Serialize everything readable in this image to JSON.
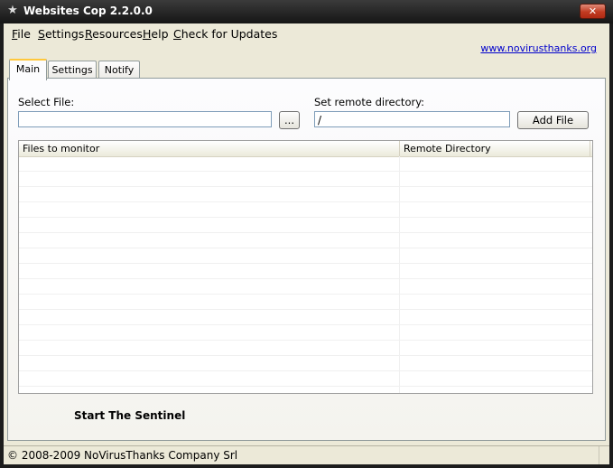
{
  "window": {
    "title": "Websites Cop 2.2.0.0",
    "close_label": "✕"
  },
  "menu": [
    {
      "label": "File",
      "underline": "F",
      "rest": "ile"
    },
    {
      "label": "Settings",
      "underline": "S",
      "rest": "ettings"
    },
    {
      "label": "Resources",
      "underline": "R",
      "rest": "esources"
    },
    {
      "label": "Help",
      "underline": "H",
      "rest": "elp"
    },
    {
      "label": "Check for Updates",
      "underline": "C",
      "rest": "heck for Updates"
    }
  ],
  "site_link": "www.novirusthanks.org",
  "tabs": [
    {
      "label": "Main",
      "active": true
    },
    {
      "label": "Settings",
      "active": false
    },
    {
      "label": "Notify",
      "active": false
    }
  ],
  "main": {
    "select_file_label": "Select File:",
    "select_file_value": "",
    "browse_label": "...",
    "remote_dir_label": "Set remote directory:",
    "remote_dir_value": "/",
    "add_file_label": "Add File",
    "list": {
      "columns": [
        "Files to monitor",
        "Remote Directory"
      ],
      "rows": []
    },
    "start_label": "Start The Sentinel"
  },
  "status": {
    "text": "© 2008-2009 NoVirusThanks Company Srl"
  }
}
